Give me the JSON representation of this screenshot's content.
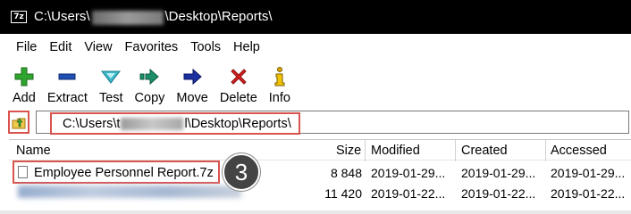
{
  "window": {
    "app_icon_text": "7z",
    "title_prefix": "C:\\Users\\",
    "title_suffix": "\\Desktop\\Reports\\"
  },
  "menu": [
    "File",
    "Edit",
    "View",
    "Favorites",
    "Tools",
    "Help"
  ],
  "toolbar": [
    {
      "label": "Add",
      "icon": "plus-icon",
      "color": "#2fa52f"
    },
    {
      "label": "Extract",
      "icon": "minus-icon",
      "color": "#1f4fb5"
    },
    {
      "label": "Test",
      "icon": "check-chevron-icon",
      "color": "#3cb7c9"
    },
    {
      "label": "Copy",
      "icon": "copy-arrow-icon",
      "color": "#1b8f6a"
    },
    {
      "label": "Move",
      "icon": "move-arrow-icon",
      "color": "#1a2fa0"
    },
    {
      "label": "Delete",
      "icon": "x-delete-icon",
      "color": "#d62020"
    },
    {
      "label": "Info",
      "icon": "info-icon",
      "color": "#d8a600"
    }
  ],
  "address": {
    "prefix": "C:\\Users\\",
    "visible_char": "t",
    "suffix": "l\\Desktop\\Reports\\"
  },
  "columns": {
    "name": "Name",
    "size": "Size",
    "modified": "Modified",
    "created": "Created",
    "accessed": "Accessed"
  },
  "rows": [
    {
      "name": "Employee Personnel Report.7z",
      "size": "8 848",
      "modified": "2019-01-29...",
      "created": "2019-01-29...",
      "accessed": "2019-01-29..."
    },
    {
      "name": "",
      "size": "11 420",
      "modified": "2019-01-22...",
      "created": "2019-01-22...",
      "accessed": "2019-01-22..."
    }
  ],
  "step_badge": "3",
  "accent_color": "#d9534f"
}
